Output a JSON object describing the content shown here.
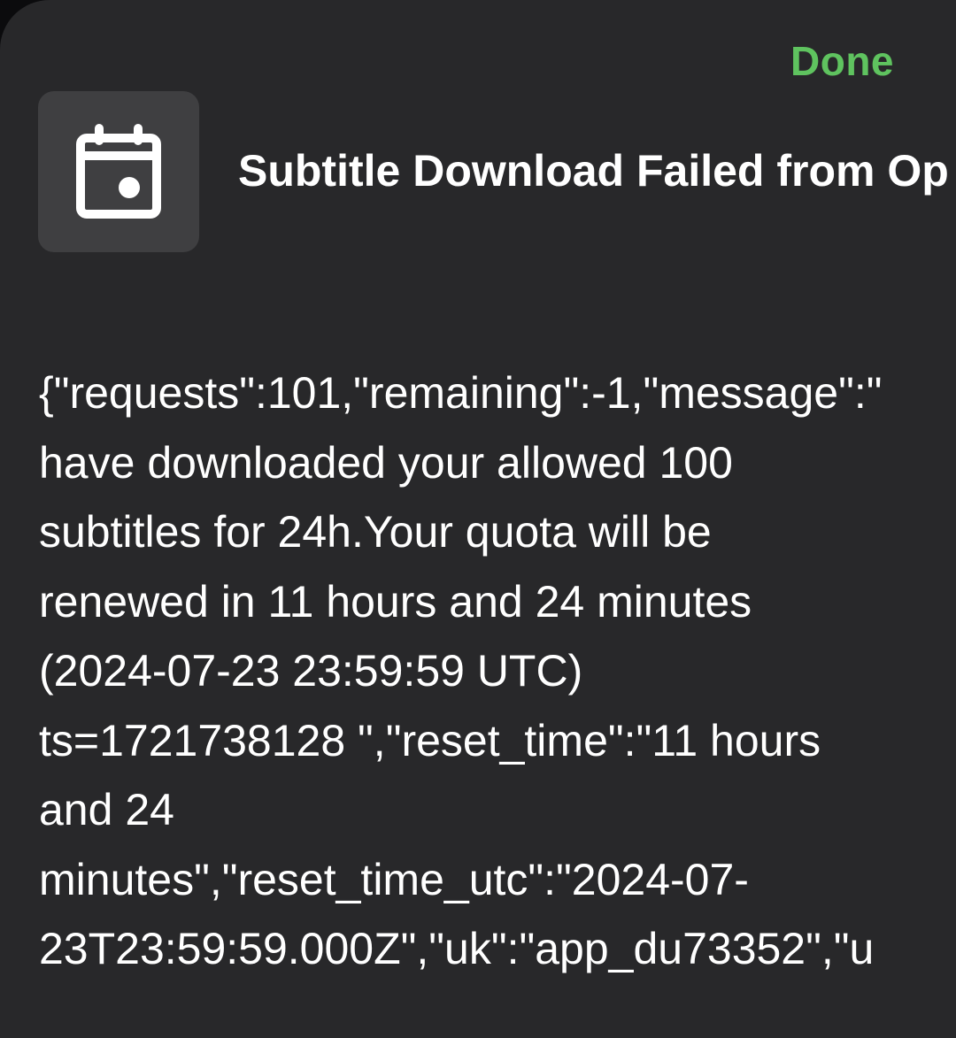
{
  "header": {
    "done_label": "Done"
  },
  "notification": {
    "icon": "calendar-icon",
    "title": "Subtitle Download Failed from Op",
    "body_lines": [
      "{\"requests\":101,\"remaining\":-1,\"message\":\"",
      "have downloaded your allowed 100",
      "subtitles for 24h.Your quota will be",
      "renewed in 11 hours and 24 minutes",
      "(2024-07-23 23:59:59 UTC)",
      "ts=1721738128 \",\"reset_time\":\"11 hours",
      "and 24",
      "minutes\",\"reset_time_utc\":\"2024-07-",
      "23T23:59:59.000Z\",\"uk\":\"app_du73352\",\"u"
    ]
  },
  "colors": {
    "background": "#28282a",
    "accent": "#5fc35f",
    "icon_tile": "#3f3f41",
    "text": "#ffffff"
  }
}
